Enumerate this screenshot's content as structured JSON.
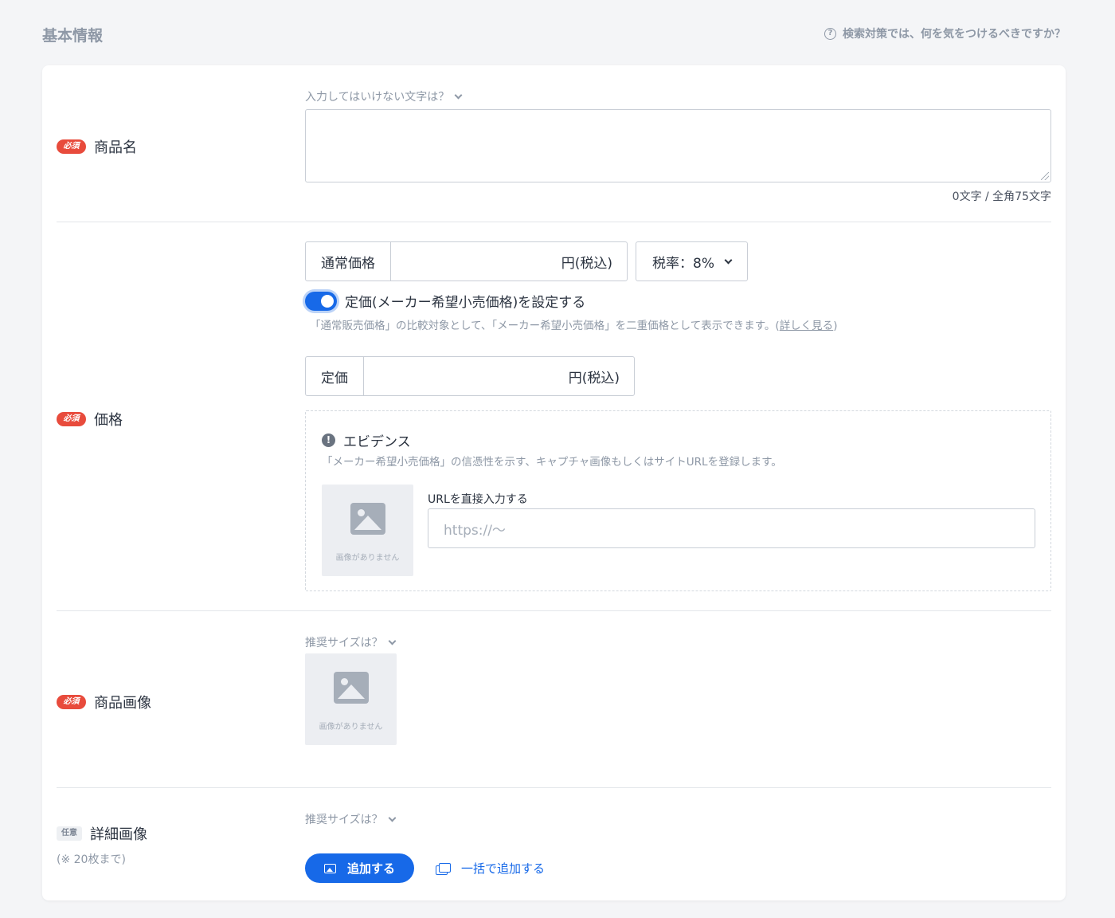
{
  "header": {
    "title": "基本情報",
    "help_icon": "question-circle-icon",
    "help_text": "検索対策では、何を気をつけるべきですか？"
  },
  "badges": {
    "required": "必須",
    "optional": "任意"
  },
  "product_name": {
    "label": "商品名",
    "hint": "入力してはいけない文字は？",
    "value": "",
    "counter": "0文字 / 全角75文字"
  },
  "price": {
    "label": "価格",
    "regular_label": "通常価格",
    "regular_unit": "円(税込)",
    "tax_select": "税率：8%",
    "toggle_on": true,
    "toggle_label": "定価(メーカー希望小売価格)を設定する",
    "note_prefix": "「通常販売価格」の比較対象として、「メーカー希望小売価格」を二重価格として表示できます。(",
    "note_link": "詳しく見る",
    "note_suffix": ")",
    "list_label": "定価",
    "list_unit": "円(税込)",
    "evidence": {
      "title": "エビデンス",
      "icon": "exclamation-circle-icon",
      "desc": "「メーカー希望小売価格」の信憑性を示す、キャプチャ画像もしくはサイトURLを登録します。",
      "no_image": "画像がありません",
      "url_label": "URLを直接入力する",
      "url_placeholder": "https://〜"
    }
  },
  "product_image": {
    "label": "商品画像",
    "hint": "推奨サイズは？",
    "no_image": "画像がありません"
  },
  "detail_image": {
    "label": "詳細画像",
    "sublabel": "(※ 20枚まで)",
    "hint": "推奨サイズは？",
    "add_button": "追加する",
    "bulk_add": "一括で追加する"
  },
  "colors": {
    "accent": "#1769e8",
    "required_badge": "#e84b3c",
    "muted_text": "#8e98a6"
  }
}
